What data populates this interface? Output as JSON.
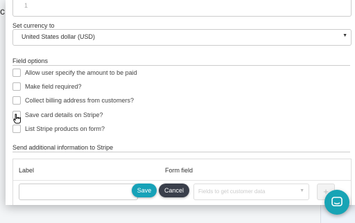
{
  "background": {
    "left_text": "c I"
  },
  "amount": {
    "value": "1"
  },
  "currency": {
    "label": "Set currency to",
    "value": "United States dollar (USD)"
  },
  "field_options": {
    "title": "Field options",
    "items": [
      {
        "label": "Allow user specify the amount to be paid",
        "checked": false
      },
      {
        "label": "Make field required?",
        "checked": false
      },
      {
        "label": "Collect billing address from customers?",
        "checked": false
      },
      {
        "label": "Save card details on Stripe?",
        "checked": false
      },
      {
        "label": "List Stripe products on form?",
        "checked": false
      }
    ]
  },
  "send_info": {
    "title": "Send additional information to Stripe",
    "col_label": "Label",
    "col_form_field": "Form field",
    "form_field_placeholder": "Fields to get customer data"
  },
  "buttons": {
    "save": "Save",
    "cancel": "Cancel",
    "add": "+"
  },
  "icons": {
    "chat": "chat-icon",
    "cursor": "hand-cursor-icon",
    "dropdown": "chevron-down-icon"
  },
  "colors": {
    "save": "#17a2b8",
    "cancel": "#3a3f4b",
    "chat": "#18a4b5"
  }
}
